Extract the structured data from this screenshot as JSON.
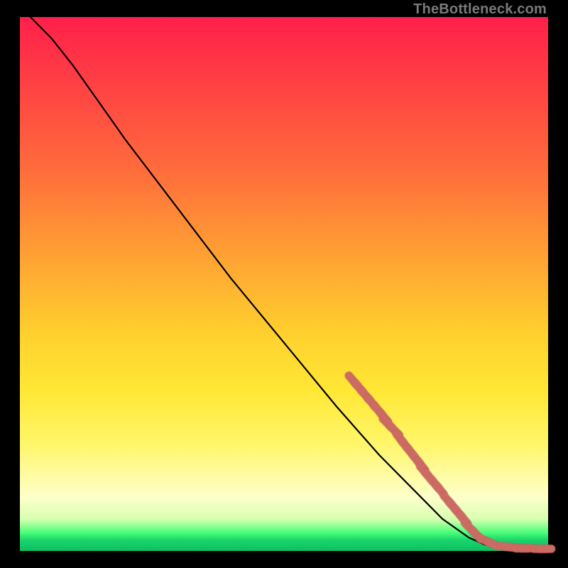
{
  "watermark": "TheBottleneck.com",
  "colors": {
    "background": "#000000",
    "curve": "#000000",
    "marker": "#cc6b63",
    "marker_stroke": "#b95a52",
    "gradient_top": "#ff1f4a",
    "gradient_mid": "#ffd22e",
    "gradient_bottom": "#0fbf62"
  },
  "chart_data": {
    "type": "line",
    "title": "",
    "xlabel": "",
    "ylabel": "",
    "xlim": [
      0,
      100
    ],
    "ylim": [
      0,
      100
    ],
    "grid": false,
    "legend": false,
    "curve": [
      {
        "x": 2,
        "y": 100
      },
      {
        "x": 6,
        "y": 96
      },
      {
        "x": 10,
        "y": 91
      },
      {
        "x": 15,
        "y": 84
      },
      {
        "x": 20,
        "y": 77
      },
      {
        "x": 30,
        "y": 64
      },
      {
        "x": 40,
        "y": 51
      },
      {
        "x": 50,
        "y": 39
      },
      {
        "x": 60,
        "y": 27
      },
      {
        "x": 68,
        "y": 18
      },
      {
        "x": 74,
        "y": 12
      },
      {
        "x": 80,
        "y": 6
      },
      {
        "x": 85,
        "y": 2.5
      },
      {
        "x": 88,
        "y": 1.2
      },
      {
        "x": 92,
        "y": 0.6
      },
      {
        "x": 96,
        "y": 0.4
      },
      {
        "x": 100,
        "y": 0.3
      }
    ],
    "marker_clusters": [
      {
        "x_start": 63,
        "y_start": 32,
        "x_end": 69,
        "y_end": 25,
        "count": 6
      },
      {
        "x_start": 69.5,
        "y_start": 24,
        "x_end": 71,
        "y_end": 22.5,
        "count": 2
      },
      {
        "x_start": 72,
        "y_start": 21,
        "x_end": 76,
        "y_end": 16,
        "count": 5
      },
      {
        "x_start": 76.5,
        "y_start": 15,
        "x_end": 79.5,
        "y_end": 11.5,
        "count": 4
      },
      {
        "x_start": 81,
        "y_start": 9.5,
        "x_end": 84,
        "y_end": 6,
        "count": 4
      },
      {
        "x_start": 85,
        "y_start": 4.5,
        "x_end": 86.5,
        "y_end": 3,
        "count": 2
      },
      {
        "x_start": 88,
        "y_start": 2,
        "x_end": 89.5,
        "y_end": 1.3,
        "count": 2
      },
      {
        "x_start": 92,
        "y_start": 0.8,
        "x_end": 93,
        "y_end": 0.7,
        "count": 2
      },
      {
        "x_start": 95,
        "y_start": 0.5,
        "x_end": 96,
        "y_end": 0.5,
        "count": 2
      },
      {
        "x_start": 98.5,
        "y_start": 0.4,
        "x_end": 99.5,
        "y_end": 0.4,
        "count": 2
      }
    ]
  }
}
